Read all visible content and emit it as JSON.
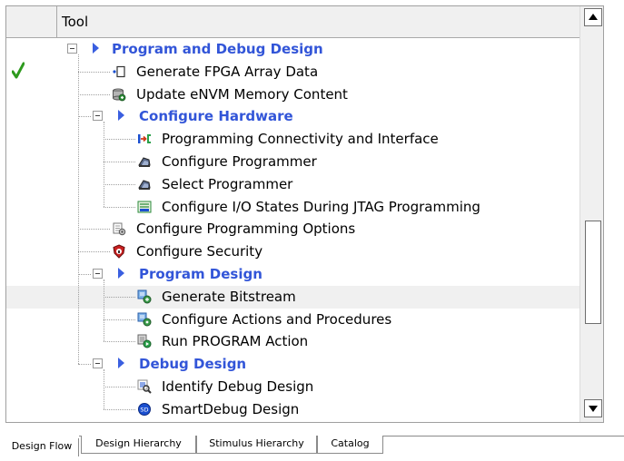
{
  "header": {
    "tool_label": "Tool"
  },
  "tree": [
    {
      "label": "Program and Debug Design",
      "type": "group",
      "expander": true,
      "status": ""
    },
    {
      "label": "Generate FPGA Array Data",
      "type": "item",
      "icon": "fpga-array-data-icon",
      "status": "check"
    },
    {
      "label": "Update eNVM Memory Content",
      "type": "item",
      "icon": "envm-memory-icon",
      "status": ""
    },
    {
      "label": "Configure Hardware",
      "type": "group",
      "expander": true,
      "status": ""
    },
    {
      "label": "Programming Connectivity and Interface",
      "type": "item",
      "icon": "programming-connectivity-icon",
      "status": ""
    },
    {
      "label": "Configure Programmer",
      "type": "item",
      "icon": "programmer-icon",
      "status": ""
    },
    {
      "label": "Select Programmer",
      "type": "item",
      "icon": "programmer-icon",
      "status": ""
    },
    {
      "label": "Configure I/O States During JTAG Programming",
      "type": "item",
      "icon": "io-states-icon",
      "status": ""
    },
    {
      "label": "Configure Programming Options",
      "type": "item",
      "icon": "programming-options-icon",
      "status": ""
    },
    {
      "label": "Configure Security",
      "type": "item",
      "icon": "security-shield-icon",
      "status": ""
    },
    {
      "label": "Program Design",
      "type": "group",
      "expander": true,
      "status": ""
    },
    {
      "label": "Generate Bitstream",
      "type": "item",
      "icon": "bitstream-icon",
      "status": "",
      "selected": true
    },
    {
      "label": "Configure Actions and Procedures",
      "type": "item",
      "icon": "actions-procedures-icon",
      "status": ""
    },
    {
      "label": "Run PROGRAM Action",
      "type": "item",
      "icon": "run-program-icon",
      "status": ""
    },
    {
      "label": "Debug Design",
      "type": "group",
      "expander": true,
      "status": ""
    },
    {
      "label": "Identify Debug Design",
      "type": "item",
      "icon": "identify-debug-icon",
      "status": ""
    },
    {
      "label": "SmartDebug Design",
      "type": "item",
      "icon": "smartdebug-icon",
      "status": ""
    }
  ],
  "tabs": [
    {
      "label": "Design Flow",
      "active": true
    },
    {
      "label": "Design Hierarchy",
      "active": false
    },
    {
      "label": "Stimulus Hierarchy",
      "active": false
    },
    {
      "label": "Catalog",
      "active": false
    }
  ],
  "colors": {
    "group_text": "#3255d8",
    "expand_triangle": "#3a5fe0",
    "checkmark": "#2e9a1e",
    "selected_row": "#f0f0f0",
    "header_bg": "#f0f0f0"
  }
}
